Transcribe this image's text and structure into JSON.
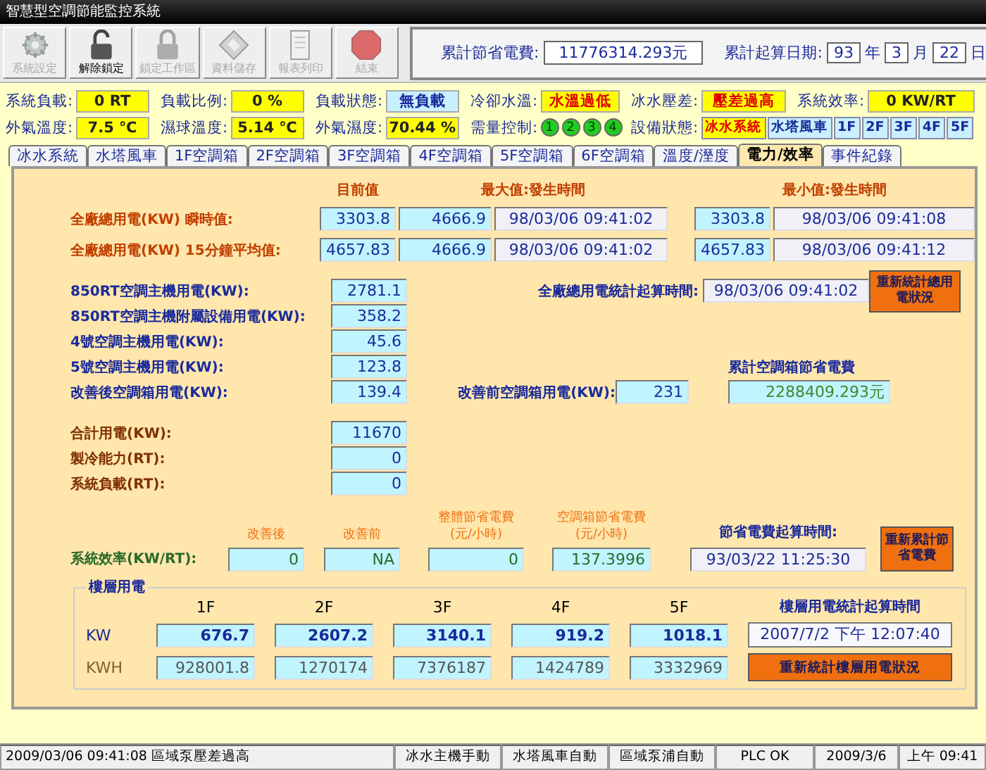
{
  "window": {
    "title": "智慧型空調節能監控系統"
  },
  "toolbar": [
    {
      "label": "系統設定",
      "kind": "gear",
      "disabled": true
    },
    {
      "label": "解除鎖定",
      "kind": "unlock",
      "disabled": false
    },
    {
      "label": "鎖定工作區",
      "kind": "lock",
      "disabled": true
    },
    {
      "label": "資料儲存",
      "kind": "disk",
      "disabled": true
    },
    {
      "label": "報表列印",
      "kind": "document",
      "disabled": true
    },
    {
      "label": "結束",
      "kind": "stop",
      "disabled": true
    }
  ],
  "summary": {
    "savings_label": "累計節省電費:",
    "savings_value": "11776314.293元",
    "start_label": "累計起算日期:",
    "year": "93",
    "year_unit": "年",
    "month": "3",
    "month_unit": "月",
    "day": "22",
    "day_unit": "日"
  },
  "status_rows": [
    [
      {
        "kind": "reading",
        "label": "系統負載:",
        "value": "0 RT"
      },
      {
        "kind": "reading",
        "label": "負載比例:",
        "value": "0 %"
      },
      {
        "kind": "state",
        "label": "負載狀態:",
        "value": "無負載"
      },
      {
        "kind": "alarm",
        "label": "冷卻水溫:",
        "value": "水溫過低"
      },
      {
        "kind": "alarm",
        "label": "冰水壓差:",
        "value": "壓差過高"
      },
      {
        "kind": "reading",
        "label": "系統效率:",
        "value": "0 KW/RT"
      }
    ],
    [
      {
        "kind": "reading",
        "label": "外氣溫度:",
        "value": "7.5 ℃"
      },
      {
        "kind": "reading",
        "label": "濕球溫度:",
        "value": "5.14 ℃"
      },
      {
        "kind": "reading",
        "label": "外氣濕度:",
        "value": "70.44 %"
      },
      {
        "kind": "lights",
        "label": "需量控制:",
        "lights": [
          {
            "label": "1",
            "on": true
          },
          {
            "label": "2",
            "on": true
          },
          {
            "label": "3",
            "on": true
          },
          {
            "label": "4",
            "on": true
          }
        ]
      },
      {
        "kind": "chips",
        "label": "設備狀態:",
        "chips": [
          {
            "label": "冰水系統",
            "alarm": true
          },
          {
            "label": "水塔風車",
            "alarm": false
          },
          {
            "label": "1F",
            "alarm": false
          },
          {
            "label": "2F",
            "alarm": false
          },
          {
            "label": "3F",
            "alarm": false
          },
          {
            "label": "4F",
            "alarm": false
          },
          {
            "label": "5F",
            "alarm": false
          }
        ]
      }
    ]
  ],
  "tabs": [
    {
      "label": "冰水系統",
      "selected": false
    },
    {
      "label": "水塔風車",
      "selected": false
    },
    {
      "label": "1F空調箱",
      "selected": false
    },
    {
      "label": "2F空調箱",
      "selected": false
    },
    {
      "label": "3F空調箱",
      "selected": false
    },
    {
      "label": "4F空調箱",
      "selected": false
    },
    {
      "label": "5F空調箱",
      "selected": false
    },
    {
      "label": "6F空調箱",
      "selected": false
    },
    {
      "label": "溫度/溼度",
      "selected": false
    },
    {
      "label": "電力/效率",
      "selected": true
    },
    {
      "label": "事件紀錄",
      "selected": false
    }
  ],
  "peak": {
    "headers": [
      "目前值",
      "最大值:發生時間",
      "最小值:發生時間"
    ],
    "rows": [
      {
        "label": "全廠總用電(KW) 瞬時值:",
        "current": "3303.8",
        "max": "4666.9",
        "max_time": "98/03/06 09:41:02",
        "min": "3303.8",
        "min_time": "98/03/06 09:41:08"
      },
      {
        "label": "全廠總用電(KW) 15分鐘平均值:",
        "current": "4657.83",
        "max": "4666.9",
        "max_time": "98/03/06 09:41:02",
        "min": "4657.83",
        "min_time": "98/03/06 09:41:12"
      }
    ]
  },
  "power": [
    {
      "label": "850RT空調主機用電(KW):",
      "value": "2781.1",
      "kind": "meter"
    },
    {
      "label": "850RT空調主機附屬設備用電(KW):",
      "value": "358.2",
      "kind": "meter"
    },
    {
      "label": "4號空調主機用電(KW):",
      "value": "45.6",
      "kind": "meter"
    },
    {
      "label": "5號空調主機用電(KW):",
      "value": "123.8",
      "kind": "meter"
    },
    {
      "label": "改善後空調箱用電(KW):",
      "value": "139.4",
      "kind": "meter"
    },
    {
      "label": "合計用電(KW):",
      "value": "11670",
      "kind": "total"
    },
    {
      "label": "製冷能力(RT):",
      "value": "0",
      "kind": "total"
    },
    {
      "label": "系統負載(RT):",
      "value": "0",
      "kind": "total"
    }
  ],
  "total_stats": {
    "label": "全廠總用電統計起算時間:",
    "value": "98/03/06 09:41:02",
    "button": "重新統計總用電狀況"
  },
  "before": {
    "label": "改善前空調箱用電(KW):",
    "value": "231"
  },
  "ac_savings": {
    "label": "累計空調箱節省電費",
    "value": "2288409.293元"
  },
  "efficiency": {
    "label": "系統效率(KW/RT):",
    "columns": [
      {
        "header": "改善後",
        "value": "0"
      },
      {
        "header": "改善前",
        "value": "NA"
      },
      {
        "header": "整體節省電費",
        "sub": "(元/小時)",
        "value": "0"
      },
      {
        "header": "空調箱節省電費",
        "sub": "(元/小時)",
        "value": "137.3996"
      }
    ],
    "start_label": "節省電費起算時間:",
    "start_value": "93/03/22 11:25:30",
    "button": "重新累計節省電費"
  },
  "floors": {
    "legend": "樓層用電",
    "columns": [
      "1F",
      "2F",
      "3F",
      "4F",
      "5F"
    ],
    "kw_label": "KW",
    "kwh_label": "KWH",
    "kw": [
      "676.7",
      "2607.2",
      "3140.1",
      "919.2",
      "1018.1"
    ],
    "kwh": [
      "928001.8",
      "1270174",
      "7376187",
      "1424789",
      "3332969"
    ],
    "start_label": "樓層用電統計起算時間",
    "start_value": "2007/7/2 下午 12:07:40",
    "button": "重新統計樓層用電狀況"
  },
  "status_bar": [
    "2009/03/06 09:41:08 區域泵壓差過高",
    "冰水主機手動",
    "水塔風車自動",
    "區域泵浦自動",
    "PLC OK",
    "2009/3/6",
    "上午 09:41"
  ]
}
